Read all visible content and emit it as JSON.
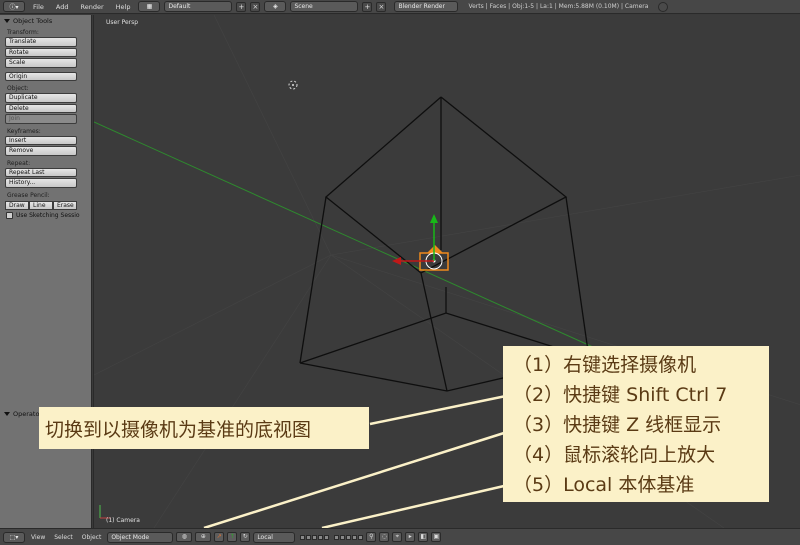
{
  "top_header": {
    "menus": [
      "File",
      "Add",
      "Render",
      "Help"
    ],
    "screen_layout": "Default",
    "scene": "Scene",
    "render_engine": "Blender Render",
    "info": "Verts | Faces | Obj:1-5 | La:1 | Mem:5.88M (0.10M) | Camera"
  },
  "tool_shelf": {
    "title": "Object Tools",
    "transform_label": "Transform:",
    "translate": "Translate",
    "rotate": "Rotate",
    "scale": "Scale",
    "origin": "Origin",
    "object_label": "Object:",
    "duplicate": "Duplicate",
    "delete": "Delete",
    "join": "Join",
    "keyframes_label": "Keyframes:",
    "insert": "Insert",
    "remove": "Remove",
    "repeat_label": "Repeat:",
    "repeat_last": "Repeat Last",
    "history": "History...",
    "grease_label": "Grease Pencil:",
    "draw": "Draw",
    "line": "Line",
    "erase": "Erase",
    "sketching": "Use Sketching Sessio",
    "operator": "Operator"
  },
  "viewport": {
    "view_name": "User Persp",
    "object_name": "(1) Camera"
  },
  "bottom_header": {
    "view": "View",
    "select": "Select",
    "object": "Object",
    "mode": "Object Mode",
    "orientation": "Local"
  },
  "callouts": {
    "left": "切换到以摄像机为基准的底视图",
    "steps": [
      "（1）右键选择摄像机",
      "（2）快捷键 Shift Ctrl 7",
      "（3）快捷键 Z 线框显示",
      "（4）鼠标滚轮向上放大",
      "（5）Local 本体基准"
    ]
  },
  "colors": {
    "callout_bg": "#fbf1c8",
    "callout_text": "#5a3a14",
    "wire": "#0e0e0e",
    "x_axis": "#c01818",
    "y_axis": "#18b818",
    "camera_orange": "#ef8a1c"
  }
}
